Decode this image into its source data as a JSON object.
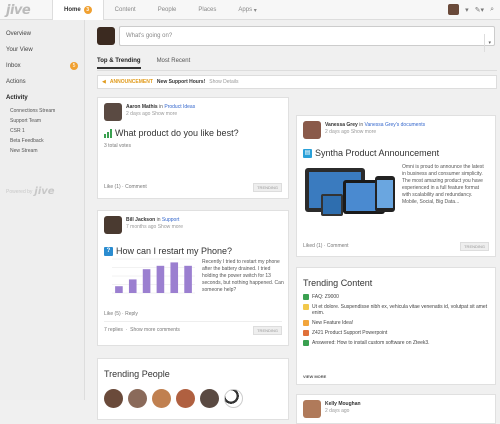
{
  "app": {
    "logo": "jive"
  },
  "nav": {
    "items": [
      {
        "label": "Home",
        "badge": "3"
      },
      {
        "label": "Content"
      },
      {
        "label": "People"
      },
      {
        "label": "Places"
      },
      {
        "label": "Apps",
        "caret": "▾"
      }
    ],
    "edit_icon": "✎▾",
    "search_icon": "⌕"
  },
  "sidebar": {
    "items": [
      {
        "label": "Overview"
      },
      {
        "label": "Your View"
      },
      {
        "label": "Inbox",
        "badge": "5"
      },
      {
        "label": "Actions"
      }
    ],
    "activity": {
      "label": "Activity",
      "subitems": [
        "Connections Stream",
        "Support Team",
        "CSR 1",
        "Beta Feedback",
        "New Stream"
      ]
    },
    "powered_by": "Powered by",
    "powered_logo": "jive"
  },
  "status": {
    "placeholder": "What's going on?",
    "caret": "▾"
  },
  "tabs": [
    "Top & Trending",
    "Most Recent"
  ],
  "announcement": {
    "tag": "ANNOUNCEMENT",
    "title": "New Support Hours!",
    "link": "Show Details"
  },
  "cards": {
    "poll": {
      "author": "Aaron Mathis",
      "in_word": "in",
      "place": "Product Ideas",
      "meta": "2 days ago",
      "more": "Show more",
      "title": "What product do you like best?",
      "votes": "3 total votes",
      "like": "Like (1) · Comment",
      "trending": "TRENDING"
    },
    "question": {
      "author": "Bill Jackson",
      "in_word": "in",
      "place": "Support",
      "meta": "7 months ago",
      "more": "Show more",
      "title": "How can I restart my Phone?",
      "body": "Recently I tried to restart my phone after the battery drained. I tried holding the power switch for 13 seconds, but nothing happened. Can someone help?",
      "like": "Like (5) · Reply",
      "replies": "7 replies",
      "more_comments": "Show more comments",
      "trending": "TRENDING"
    },
    "doc": {
      "author": "Vanessa Grey",
      "in_word": "in",
      "place": "Vanessa Grey's documents",
      "meta": "2 days ago",
      "more": "Show more",
      "title": "Syntha Product Announcement",
      "body": "Omni is proud to announce the latest in business and consumer simplicity. The most amazing product you have experienced in a full feature format with scalability and redundancy. Mobile, Social, Big Data...",
      "like": "Liked (1) · Comment",
      "trending": "TRENDING"
    },
    "trending_content": {
      "title": "Trending Content",
      "items": [
        {
          "text": "FAQ: Z9000",
          "color": "#3aa050"
        },
        {
          "text": "Ut et dolore. Suspendisse nibh ex, vehicula vitae venenatis id, volutpat sit amet enim.",
          "color": "#f2c84b"
        },
        {
          "text": "New Feature Idea!",
          "color": "#f2a53c"
        },
        {
          "text": "Z421 Product Support Powerpoint",
          "color": "#e0703a"
        },
        {
          "text": "Answered: How to install custom software on Zteek3.",
          "color": "#3aa050"
        }
      ],
      "view_more": "VIEW MORE"
    },
    "trending_people": {
      "title": "Trending People"
    },
    "kelly": {
      "author": "Kelly Moughan",
      "meta": "2 days ago"
    }
  },
  "chart_data": {
    "type": "bar",
    "categories": [
      "1",
      "2",
      "3",
      "4",
      "5",
      "6"
    ],
    "values": [
      2,
      4,
      7,
      8,
      9,
      8
    ],
    "ylim": [
      0,
      10
    ]
  }
}
